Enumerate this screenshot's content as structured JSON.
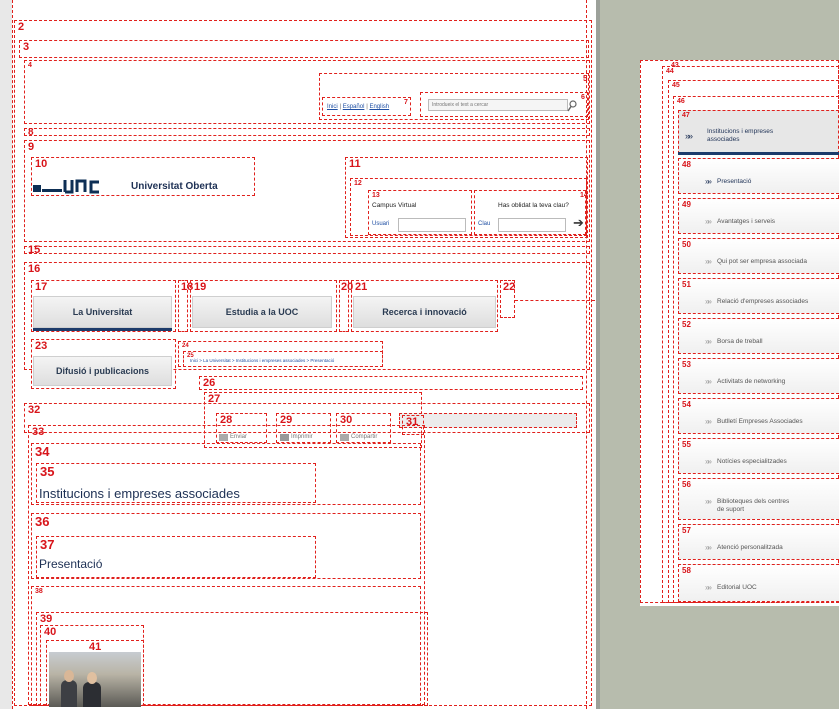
{
  "top_links": {
    "inici": "Inici",
    "espanol": "Español",
    "english": "English"
  },
  "search": {
    "placeholder": "Introdueix el text a cercar"
  },
  "logo": {
    "name": "Universitat Oberta"
  },
  "campus": {
    "title": "Campus Virtual",
    "user_label": "Usuari",
    "forgot": "Has oblidat la teva clau?",
    "key_label": "Clau"
  },
  "nav": {
    "universitat": "La Universitat",
    "estudia": "Estudia a la UOC",
    "recerca": "Recerca i innovació",
    "difusio": "Difusió i publicacions"
  },
  "breadcrumb": "Inici > La Universitat > Institucions i empreses associades > Presentació",
  "share": {
    "enviar": "Enviar",
    "imprimir": "Imprimir",
    "compartir": "Compartir"
  },
  "page": {
    "title": "Institucions i empreses associades",
    "subtitle": "Presentació"
  },
  "sidebar": {
    "header": "Institucions i empreses associades",
    "items": [
      {
        "num": "48",
        "label": "Presentació",
        "active": true
      },
      {
        "num": "49",
        "label": "Avantatges i serveis"
      },
      {
        "num": "50",
        "label": "Qui pot ser empresa associada"
      },
      {
        "num": "51",
        "label": "Relació d'empreses associades"
      },
      {
        "num": "52",
        "label": "Borsa de treball"
      },
      {
        "num": "53",
        "label": "Activitats de networking"
      },
      {
        "num": "54",
        "label": "Butlletí Empreses Associades"
      },
      {
        "num": "55",
        "label": "Notícies especialitzades"
      },
      {
        "num": "56",
        "label": "Biblioteques dels centres de suport"
      },
      {
        "num": "57",
        "label": "Atenció personalitzada"
      },
      {
        "num": "58",
        "label": "Editorial UOC"
      }
    ]
  },
  "box_numbers": [
    "2",
    "3",
    "4",
    "5",
    "6",
    "7",
    "8",
    "9",
    "10",
    "11",
    "12",
    "13",
    "14",
    "15",
    "16",
    "17",
    "18",
    "19",
    "20",
    "21",
    "22",
    "23",
    "24",
    "25",
    "26",
    "27",
    "28",
    "29",
    "30",
    "31",
    "32",
    "33",
    "34",
    "35",
    "36",
    "37",
    "38",
    "39",
    "40",
    "41",
    "43",
    "44",
    "45",
    "46",
    "47"
  ],
  "colors": {
    "accent": "#1d3b6a",
    "annotation": "#e0201c",
    "backdrop": "#b7bcad"
  }
}
